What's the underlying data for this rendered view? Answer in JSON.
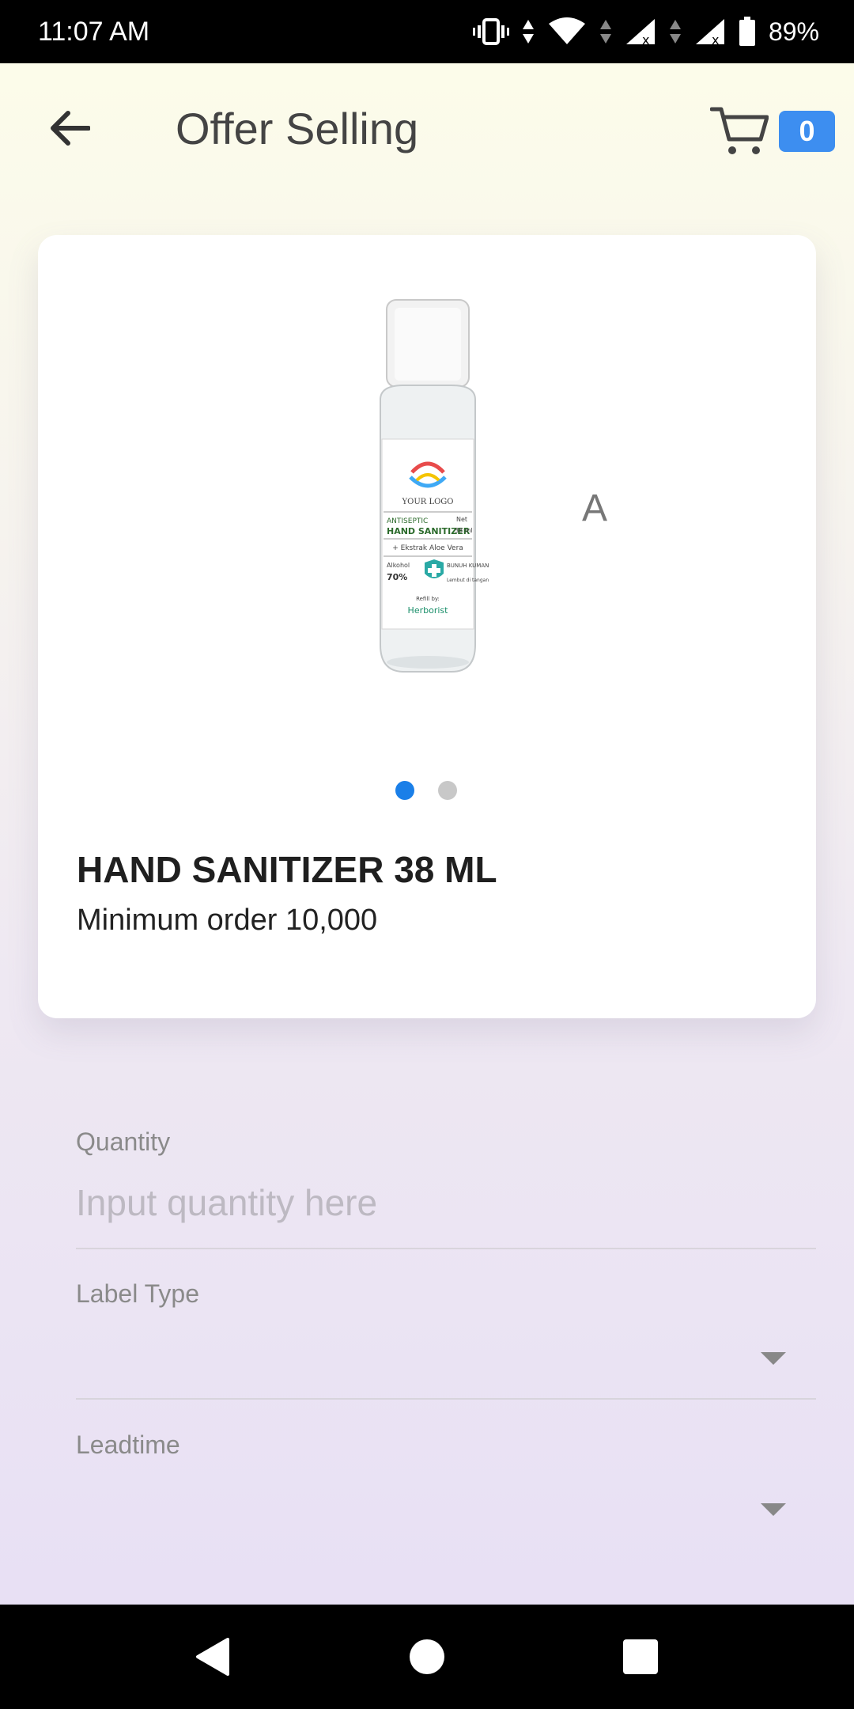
{
  "status_bar": {
    "time": "11:07 AM",
    "battery": "89%"
  },
  "app_bar": {
    "title": "Offer Selling",
    "back_icon": "arrow-left-icon",
    "cart_icon": "cart-icon",
    "cart_count": "0"
  },
  "product": {
    "image_icon": "hand-sanitizer-bottle-image",
    "image_texts": {
      "logo": "YOUR LOGO",
      "line1": "ANTISEPTIC",
      "line2": "HAND SANITIZER",
      "volume_label": "Net",
      "volume": "38 ml",
      "ingredient": "+ Ekstrak Aloe Vera",
      "alcohol_label": "Alkohol",
      "alcohol": "70%",
      "claim1": "BUNUH KUMAN",
      "claim2": "Lembut di tangan",
      "refill": "Refill by:",
      "brand": "Herborist"
    },
    "slide_letter": "A",
    "carousel_pages": 2,
    "carousel_active": 1,
    "name": "HAND SANITIZER 38 ML",
    "min_order": "Minimum order 10,000"
  },
  "form": {
    "quantity": {
      "label": "Quantity",
      "placeholder": "Input quantity here",
      "value": ""
    },
    "label_type": {
      "label": "Label Type",
      "value": ""
    },
    "leadtime": {
      "label": "Leadtime",
      "value": ""
    }
  },
  "colors": {
    "accent": "#3d8ef0",
    "dot_active": "#1a7fe8",
    "dot_inactive": "#c8c8c8"
  }
}
